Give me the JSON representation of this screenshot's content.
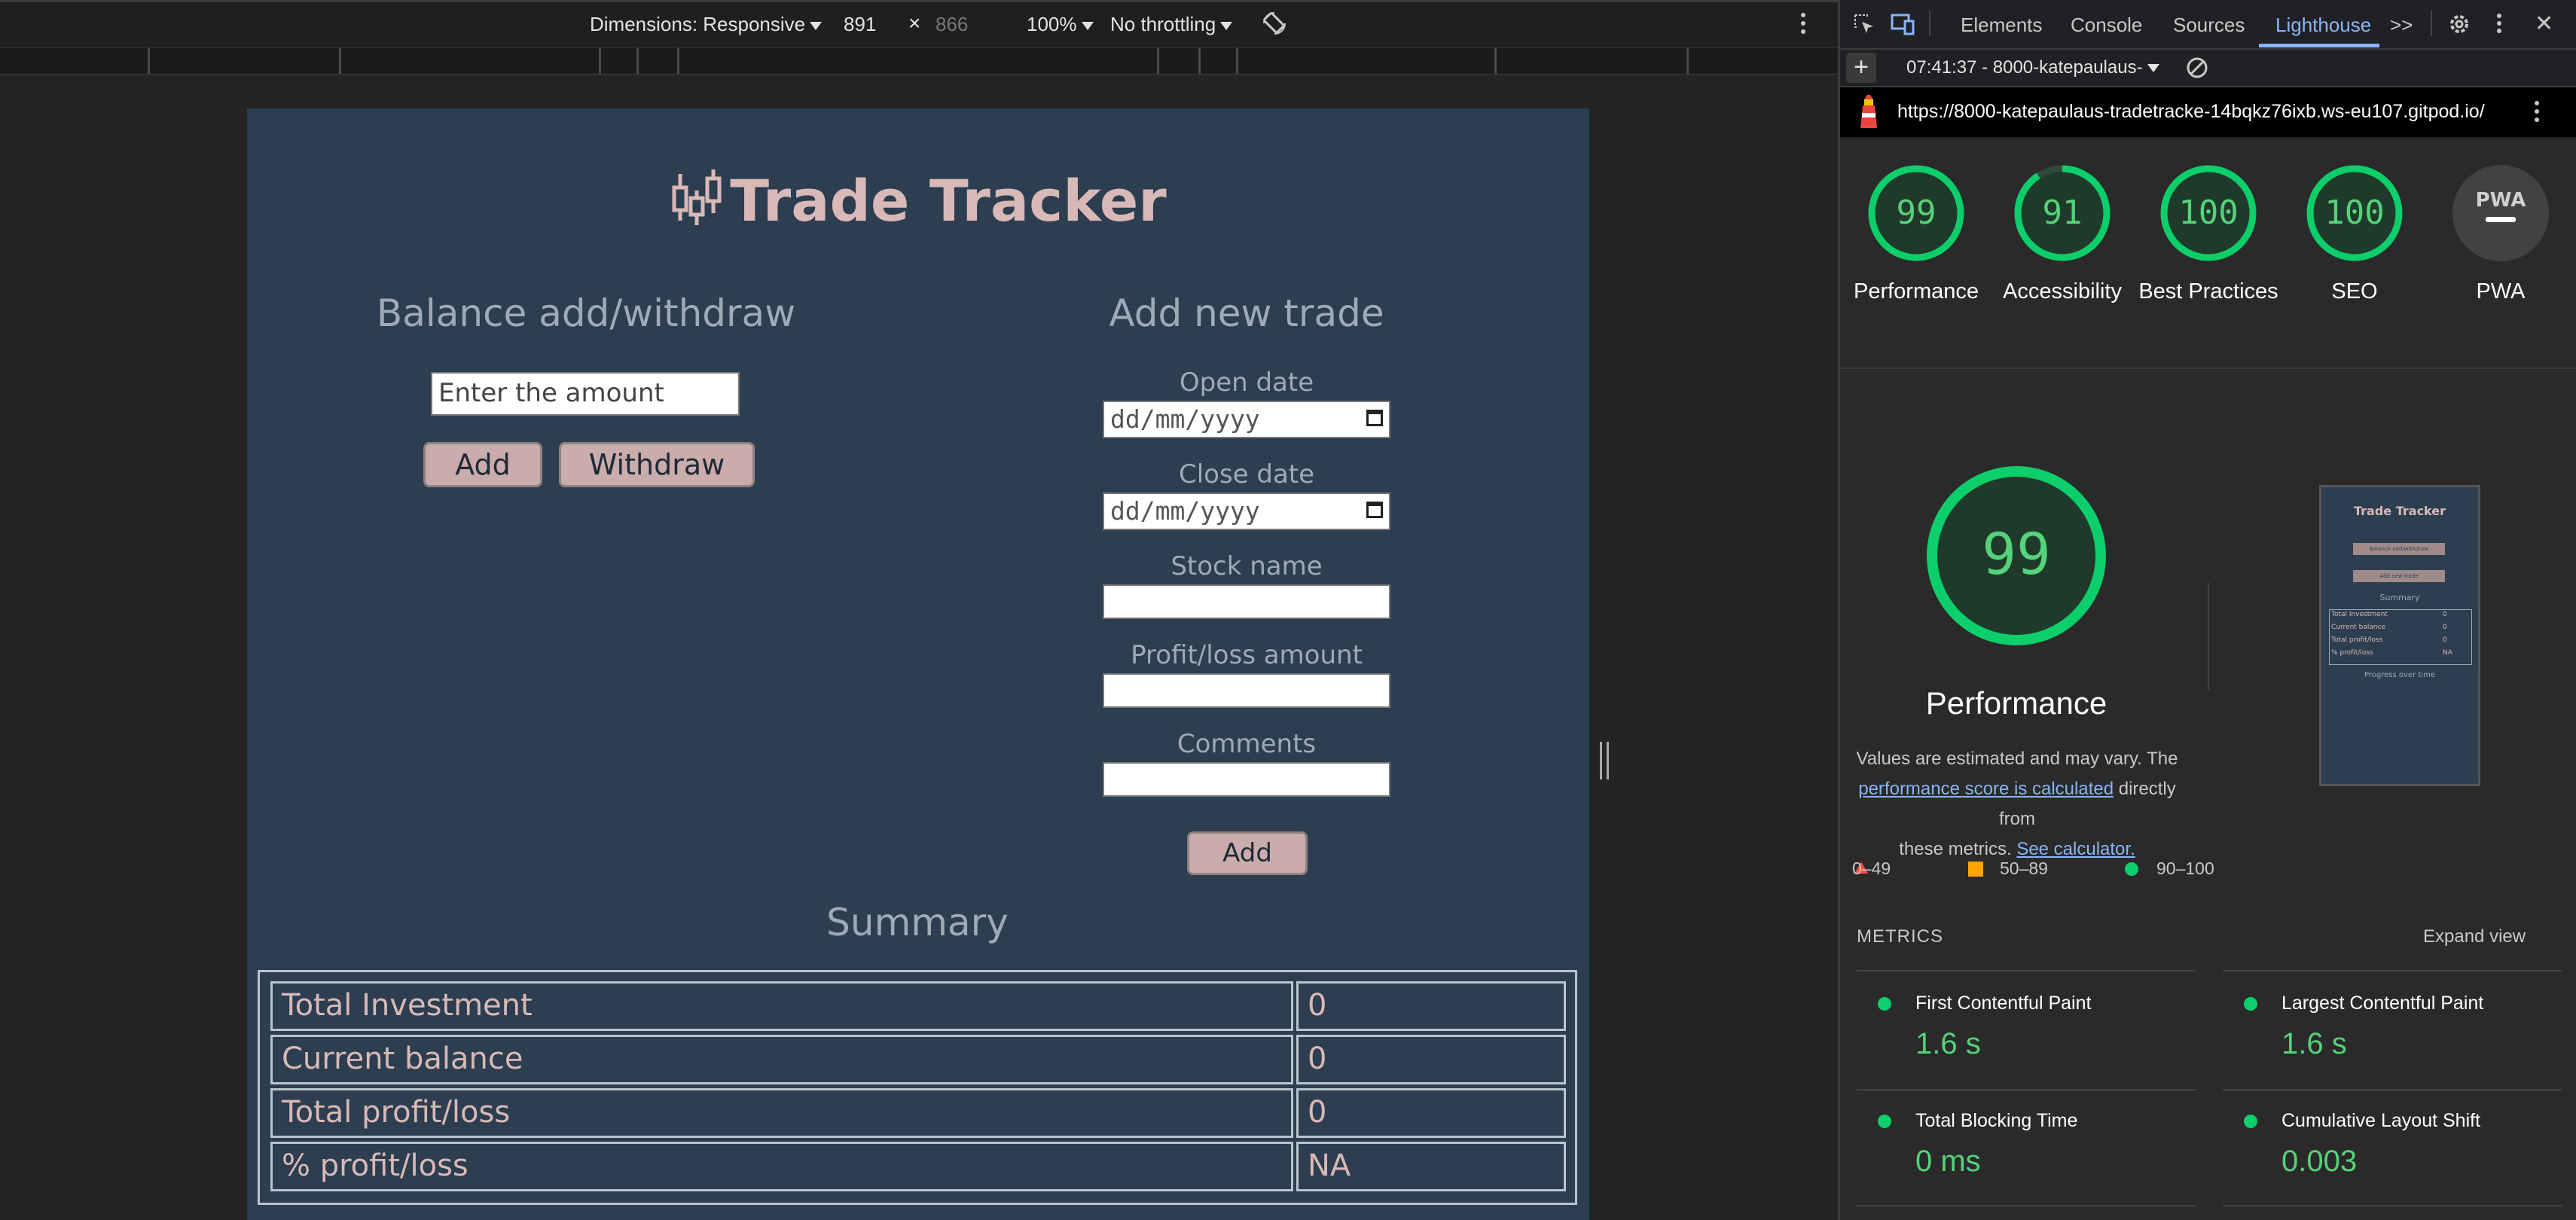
{
  "device_toolbar": {
    "dimensions_label": "Dimensions: Responsive",
    "width": "891",
    "times": "×",
    "height": "866",
    "zoom": "100%",
    "throttling": "No throttling",
    "more_icon": "kebab-icon",
    "rotate_icon": "rotate-icon"
  },
  "app": {
    "title": "Trade Tracker",
    "logo_icon": "candlestick-chart-icon",
    "balance_section": {
      "title": "Balance add/withdraw",
      "amount_placeholder": "Enter the amount",
      "add_button": "Add",
      "withdraw_button": "Withdraw"
    },
    "trade_section": {
      "title": "Add new trade",
      "open_date_label": "Open date",
      "open_date_placeholder": "dd/mm/yyyy",
      "close_date_label": "Close date",
      "close_date_placeholder": "dd/mm/yyyy",
      "stock_name_label": "Stock name",
      "profit_loss_label": "Profit/loss amount",
      "comments_label": "Comments",
      "add_button": "Add"
    },
    "summary": {
      "title": "Summary",
      "rows": [
        {
          "label": "Total Investment",
          "value": "0"
        },
        {
          "label": "Current balance",
          "value": "0"
        },
        {
          "label": "Total profit/loss",
          "value": "0"
        },
        {
          "label": "% profit/loss",
          "value": "NA"
        }
      ]
    }
  },
  "devtools": {
    "tabs": [
      "Elements",
      "Console",
      "Sources",
      "Lighthouse"
    ],
    "active_tab": "Lighthouse",
    "more_tabs": ">>",
    "report_selector": "07:41:37 - 8000-katepaulaus-",
    "url": "https://8000-katepaulaus-tradetracke-14bqkz76ixb.ws-eu107.gitpod.io/",
    "scores": [
      {
        "label": "Performance",
        "score": "99"
      },
      {
        "label": "Accessibility",
        "score": "91"
      },
      {
        "label": "Best Practices",
        "score": "100"
      },
      {
        "label": "SEO",
        "score": "100"
      },
      {
        "label": "PWA",
        "score": "PWA"
      }
    ],
    "main_score": "99",
    "main_label": "Performance",
    "note_part1": "Values are estimated and may vary. The",
    "note_link1": "performance score is calculated",
    "note_part2": "directly from",
    "note_part3": "these metrics.",
    "note_link2": "See calculator.",
    "legend": [
      "0–49",
      "50–89",
      "90–100"
    ],
    "metrics_header": "METRICS",
    "expand_view": "Expand view",
    "metrics": [
      {
        "name": "First Contentful Paint",
        "value": "1.6 s"
      },
      {
        "name": "Largest Contentful Paint",
        "value": "1.6 s"
      },
      {
        "name": "Total Blocking Time",
        "value": "0 ms"
      },
      {
        "name": "Cumulative Layout Shift",
        "value": "0.003"
      }
    ],
    "thumbnail": {
      "title": "Trade Tracker",
      "button1": "Balance add/withdraw",
      "button2": "Add new trade",
      "summary": "Summary",
      "rows": [
        "Total Investment",
        "Current balance",
        "Total profit/loss",
        "% profit/loss"
      ],
      "values": [
        "0",
        "0",
        "0",
        "NA"
      ],
      "progress": "Progress over time"
    },
    "colors": {
      "good": "#0cce6b",
      "average": "#ffa400",
      "accent": "#8ab4f8"
    }
  }
}
